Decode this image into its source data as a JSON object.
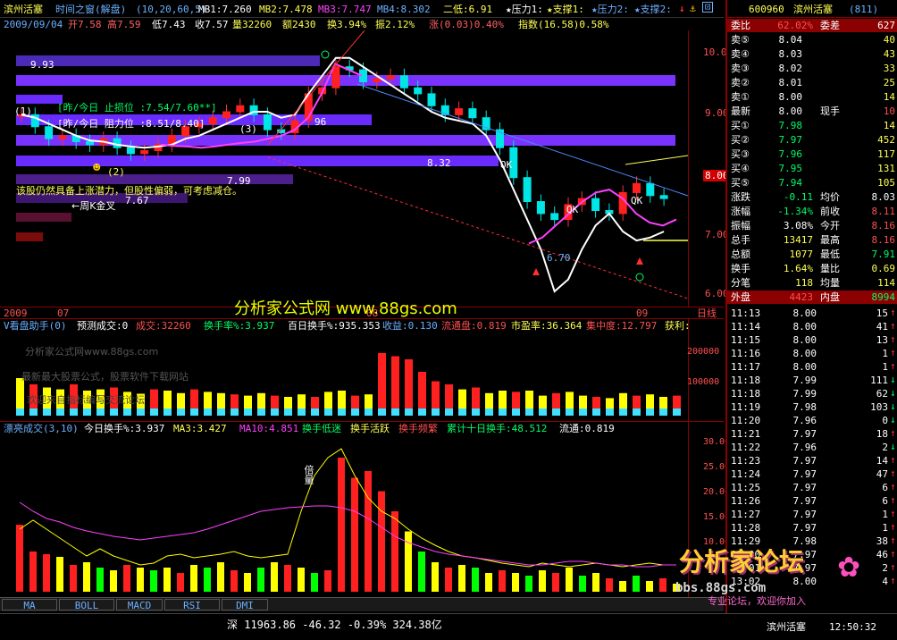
{
  "title_bar": {
    "stock": "滨州活塞",
    "indicator": "时间之窗(解盘)",
    "params": "(10,20,60,5)",
    "mb1": "MB1:7.260",
    "mb2": "MB2:7.478",
    "mb3": "MB3:7.747",
    "mb4": "MB4:8.302",
    "erdi": "二低:6.91",
    "legend1": "★压力1:",
    "legend2": "★支撑1:",
    "legend3": "★压力2:",
    "legend4": "★支撑2:"
  },
  "ohlc_bar": {
    "date": "2009/09/04",
    "open": "开7.58",
    "high": "高7.59",
    "low": "低7.43",
    "close": "收7.57",
    "vol": "量32260",
    "amt": "额2430",
    "turn": "换3.94%",
    "amp": "振2.12%",
    "chg": "涨(0.03)0.40%",
    "index": "指数(16.58)0.58%"
  },
  "chart_labels": {
    "box_993": "9.93",
    "box_9.93b": "9.93",
    "yest_stop": "[昨/今日 止损位 :7.54/7.60**]",
    "yest_res": "[昨/今日 阻力位 :8.51/8.40]",
    "advice": "该股仍然具备上涨潜力，但股性偏弱，可考虑减仓。",
    "weekly_kdj": "←周K金叉",
    "v799": "7.99",
    "v767": "7.67",
    "v832": "8.32",
    "v670": "6.70",
    "v96": "96",
    "qk1": "QK",
    "qk2": "QK",
    "qk3": "QK",
    "m1": "(1)",
    "m2": "(2)",
    "m3": "(3)",
    "mark_last": "8.00"
  },
  "y_axis_main": [
    "10.00",
    "9.00",
    "8.00",
    "7.00",
    "6.00"
  ],
  "x_axis": {
    "start": "2009",
    "m07": "07",
    "m08": "08",
    "m09": "09",
    "days": "日线"
  },
  "watermark": {
    "main": "分析家公式网 www.88gs.com",
    "sub1": "分析家公式网www.88gs.com",
    "sub2": "最新最大股票公式，股票软件下载网站",
    "sub3": "欢迎来自指标编写交流论坛",
    "bbs": "bbs.88gs.com",
    "forum": "分析家论坛",
    "slogan": "专业论坛，欢迎你加入"
  },
  "vol_panel": {
    "name": "V看盘助手(0)",
    "pred": "预测成交:0",
    "cj": "成交:32260",
    "hsl": "换手率%:3.937",
    "bsl": "百日换手%:935.353",
    "sy": "收益:0.130",
    "ltp": "流通盘:0.819",
    "syl": "市盈率:36.364",
    "jzd": "集中度:12.797",
    "hl": "获利:",
    "y": [
      "200000",
      "100000"
    ]
  },
  "turn_panel": {
    "name": "漂亮成交(3,10)",
    "jr": "今日换手%:3.937",
    "ma3": "MA3:3.427",
    "ma10": "MA10:4.851",
    "dc": "换手低迷",
    "hy": "换手活跃",
    "pf": "换手频繁",
    "lj": "累计十日换手:48.512",
    "lt": "流通:0.819",
    "y": [
      "30.00",
      "25.00",
      "20.00",
      "15.00",
      "10.00"
    ],
    "beiliang": "倍量"
  },
  "tabs": [
    "MA",
    "BOLL",
    "MACD",
    "RSI",
    "DMI"
  ],
  "status": {
    "index": "深 11963.86 -46.32 -0.39% 324.38亿",
    "stock": "滨州活塞",
    "time": "12:50:32"
  },
  "quote": {
    "code": "600960",
    "name": "滨州活塞",
    "num": "(811)",
    "weibi_l": "委比",
    "weibi": "62.02%",
    "weicha_l": "委差",
    "weicha": "627",
    "sells": [
      {
        "l": "卖⑤",
        "p": "8.04",
        "v": "40"
      },
      {
        "l": "卖④",
        "p": "8.03",
        "v": "43"
      },
      {
        "l": "卖③",
        "p": "8.02",
        "v": "33"
      },
      {
        "l": "卖②",
        "p": "8.01",
        "v": "25"
      },
      {
        "l": "卖①",
        "p": "8.00",
        "v": "14"
      }
    ],
    "last_l": "最新",
    "last": "8.00",
    "xs_l": "现手",
    "xs": "10",
    "buys": [
      {
        "l": "买①",
        "p": "7.98",
        "v": "14"
      },
      {
        "l": "买②",
        "p": "7.97",
        "v": "452"
      },
      {
        "l": "买③",
        "p": "7.96",
        "v": "117"
      },
      {
        "l": "买④",
        "p": "7.95",
        "v": "131"
      },
      {
        "l": "买⑤",
        "p": "7.94",
        "v": "105"
      }
    ],
    "stats": [
      [
        "涨跌",
        "-0.11",
        "均价",
        "8.03"
      ],
      [
        "涨幅",
        "-1.34%",
        "前收",
        "8.11"
      ],
      [
        "振幅",
        "3.08%",
        "今开",
        "8.16"
      ],
      [
        "总手",
        "13417",
        "最高",
        "8.16"
      ],
      [
        "总额",
        "1077",
        "最低",
        "7.91"
      ],
      [
        "换手",
        "1.64%",
        "量比",
        "0.69"
      ],
      [
        "分笔",
        "118",
        "均量",
        "114"
      ]
    ],
    "waipan_l": "外盘",
    "waipan": "4423",
    "neipan_l": "内盘",
    "neipan": "8994"
  },
  "ticks": [
    [
      "11:13",
      "8.00",
      "15"
    ],
    [
      "11:14",
      "8.00",
      "41"
    ],
    [
      "11:15",
      "8.00",
      "13"
    ],
    [
      "11:16",
      "8.00",
      "1"
    ],
    [
      "11:17",
      "8.00",
      "1"
    ],
    [
      "11:18",
      "7.99",
      "111"
    ],
    [
      "11:18",
      "7.99",
      "62"
    ],
    [
      "11:19",
      "7.98",
      "103"
    ],
    [
      "11:20",
      "7.96",
      "0"
    ],
    [
      "11:21",
      "7.97",
      "18"
    ],
    [
      "11:22",
      "7.96",
      "2"
    ],
    [
      "11:23",
      "7.97",
      "14"
    ],
    [
      "11:24",
      "7.97",
      "47"
    ],
    [
      "11:25",
      "7.97",
      "6"
    ],
    [
      "11:26",
      "7.97",
      "6"
    ],
    [
      "11:27",
      "7.97",
      "1"
    ],
    [
      "11:28",
      "7.97",
      "1"
    ],
    [
      "11:29",
      "7.98",
      "38"
    ],
    [
      "13:00",
      "7.97",
      "46"
    ],
    [
      "13:01",
      "7.97",
      "2"
    ],
    [
      "13:02",
      "8.00",
      "4"
    ]
  ],
  "colors": {
    "up": "#ff3030",
    "down": "#00e5e5",
    "yellow": "#ffff00",
    "purple": "#6a2bff"
  }
}
